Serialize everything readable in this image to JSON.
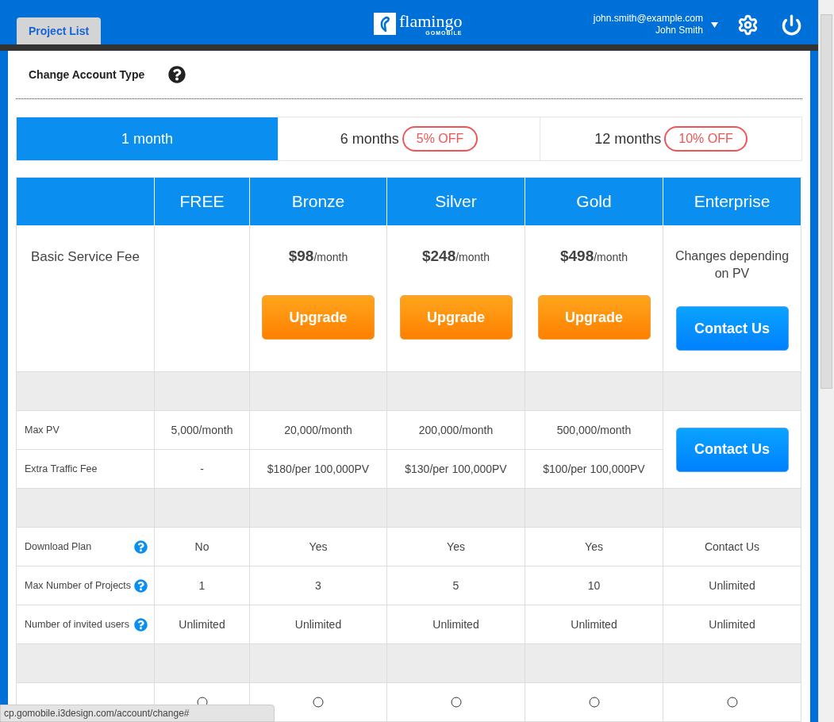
{
  "header": {
    "tab": {
      "label": "Project List",
      "selected": true
    },
    "logo": {
      "name": "flamingo",
      "sub": "GOMOBILE"
    },
    "user": {
      "email": "john.smith@example.com",
      "name": "John Smith"
    }
  },
  "page_title": "Change Account Type",
  "periods": [
    {
      "label": "1 month",
      "selected": true
    },
    {
      "label": "6 months",
      "selected": false,
      "badge": "5% OFF"
    },
    {
      "label": "12 months",
      "selected": false,
      "badge": "10% OFF"
    }
  ],
  "plans": [
    "FREE",
    "Bronze",
    "Silver",
    "Gold",
    "Enterprise"
  ],
  "fee_row": {
    "label": "Basic Service Fee",
    "cells": [
      {
        "kind": "none"
      },
      {
        "kind": "price",
        "price": "$98",
        "per": "/month",
        "button": "Upgrade"
      },
      {
        "kind": "price",
        "price": "$248",
        "per": "/month",
        "button": "Upgrade"
      },
      {
        "kind": "price",
        "price": "$498",
        "per": "/month",
        "button": "Upgrade"
      },
      {
        "kind": "text",
        "text": "Changes depending on PV",
        "button": "Contact Us"
      }
    ]
  },
  "sections": [
    {
      "side_button": "Contact Us",
      "rows": [
        {
          "label": "Max PV",
          "help": false,
          "cells": [
            {
              "kind": "text",
              "text": "5,000/month"
            },
            {
              "kind": "text",
              "text": "20,000/month"
            },
            {
              "kind": "text",
              "text": "200,000/month"
            },
            {
              "kind": "text",
              "text": "500,000/month"
            }
          ]
        },
        {
          "label": "Extra Traffic Fee",
          "help": false,
          "cells": [
            {
              "kind": "text",
              "text": "-"
            },
            {
              "kind": "text",
              "text": "$180/per 100,000PV"
            },
            {
              "kind": "text",
              "text": "$130/per 100,000PV"
            },
            {
              "kind": "text",
              "text": "$100/per 100,000PV"
            }
          ]
        }
      ]
    },
    {
      "rows": [
        {
          "label": "Download Plan",
          "help": true,
          "cells": [
            {
              "kind": "text",
              "text": "No"
            },
            {
              "kind": "text",
              "text": "Yes"
            },
            {
              "kind": "text",
              "text": "Yes"
            },
            {
              "kind": "text",
              "text": "Yes"
            },
            {
              "kind": "text",
              "text": "Contact Us"
            }
          ]
        },
        {
          "label": "Max Number of Projects",
          "help": true,
          "cells": [
            {
              "kind": "text",
              "text": "1"
            },
            {
              "kind": "text",
              "text": "3"
            },
            {
              "kind": "text",
              "text": "5"
            },
            {
              "kind": "text",
              "text": "10"
            },
            {
              "kind": "text",
              "text": "Unlimited"
            }
          ]
        },
        {
          "label": "Number of invited users",
          "help": true,
          "cells": [
            {
              "kind": "text",
              "text": "Unlimited"
            },
            {
              "kind": "text",
              "text": "Unlimited"
            },
            {
              "kind": "text",
              "text": "Unlimited"
            },
            {
              "kind": "text",
              "text": "Unlimited"
            },
            {
              "kind": "text",
              "text": "Unlimited"
            }
          ]
        }
      ]
    },
    {
      "rows": [
        {
          "cells": [
            {
              "kind": "circle"
            },
            {
              "kind": "circle"
            },
            {
              "kind": "circle"
            },
            {
              "kind": "circle"
            },
            {
              "kind": "circle"
            }
          ]
        }
      ]
    }
  ],
  "status_url": "cp.gomobile.i3design.com/account/change#"
}
